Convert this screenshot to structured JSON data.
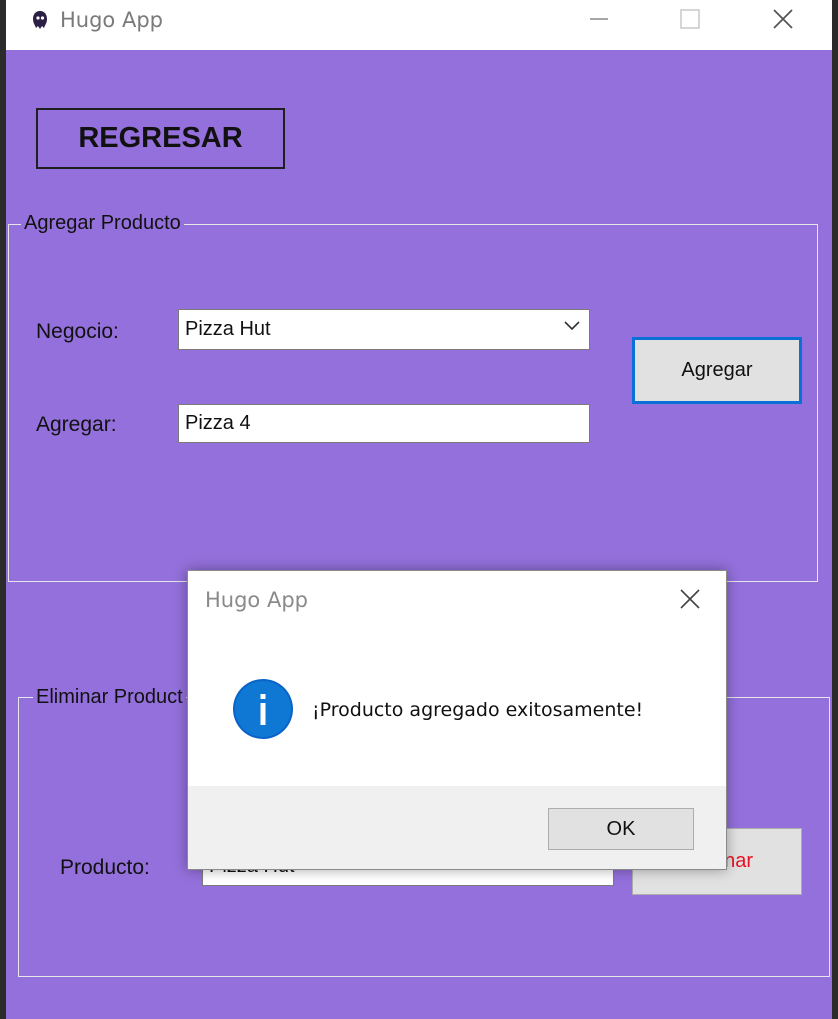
{
  "window": {
    "title": "Hugo App",
    "bg_color": "#9370db"
  },
  "regresar_label": "REGRESAR",
  "add_group": {
    "legend": "Agregar Producto",
    "negocio_label": "Negocio:",
    "negocio_value": "Pizza Hut",
    "agregar_label": "Agregar:",
    "agregar_value": "Pizza 4",
    "agregar_button": "Agregar"
  },
  "delete_group": {
    "legend": "Eliminar Product",
    "producto_label": "Producto:",
    "producto_value": "Pizza Hut",
    "eliminar_button": "nar"
  },
  "dialog": {
    "title": "Hugo App",
    "message": "¡Producto agregado exitosamente!",
    "ok_label": "OK",
    "icon": "info-icon"
  }
}
